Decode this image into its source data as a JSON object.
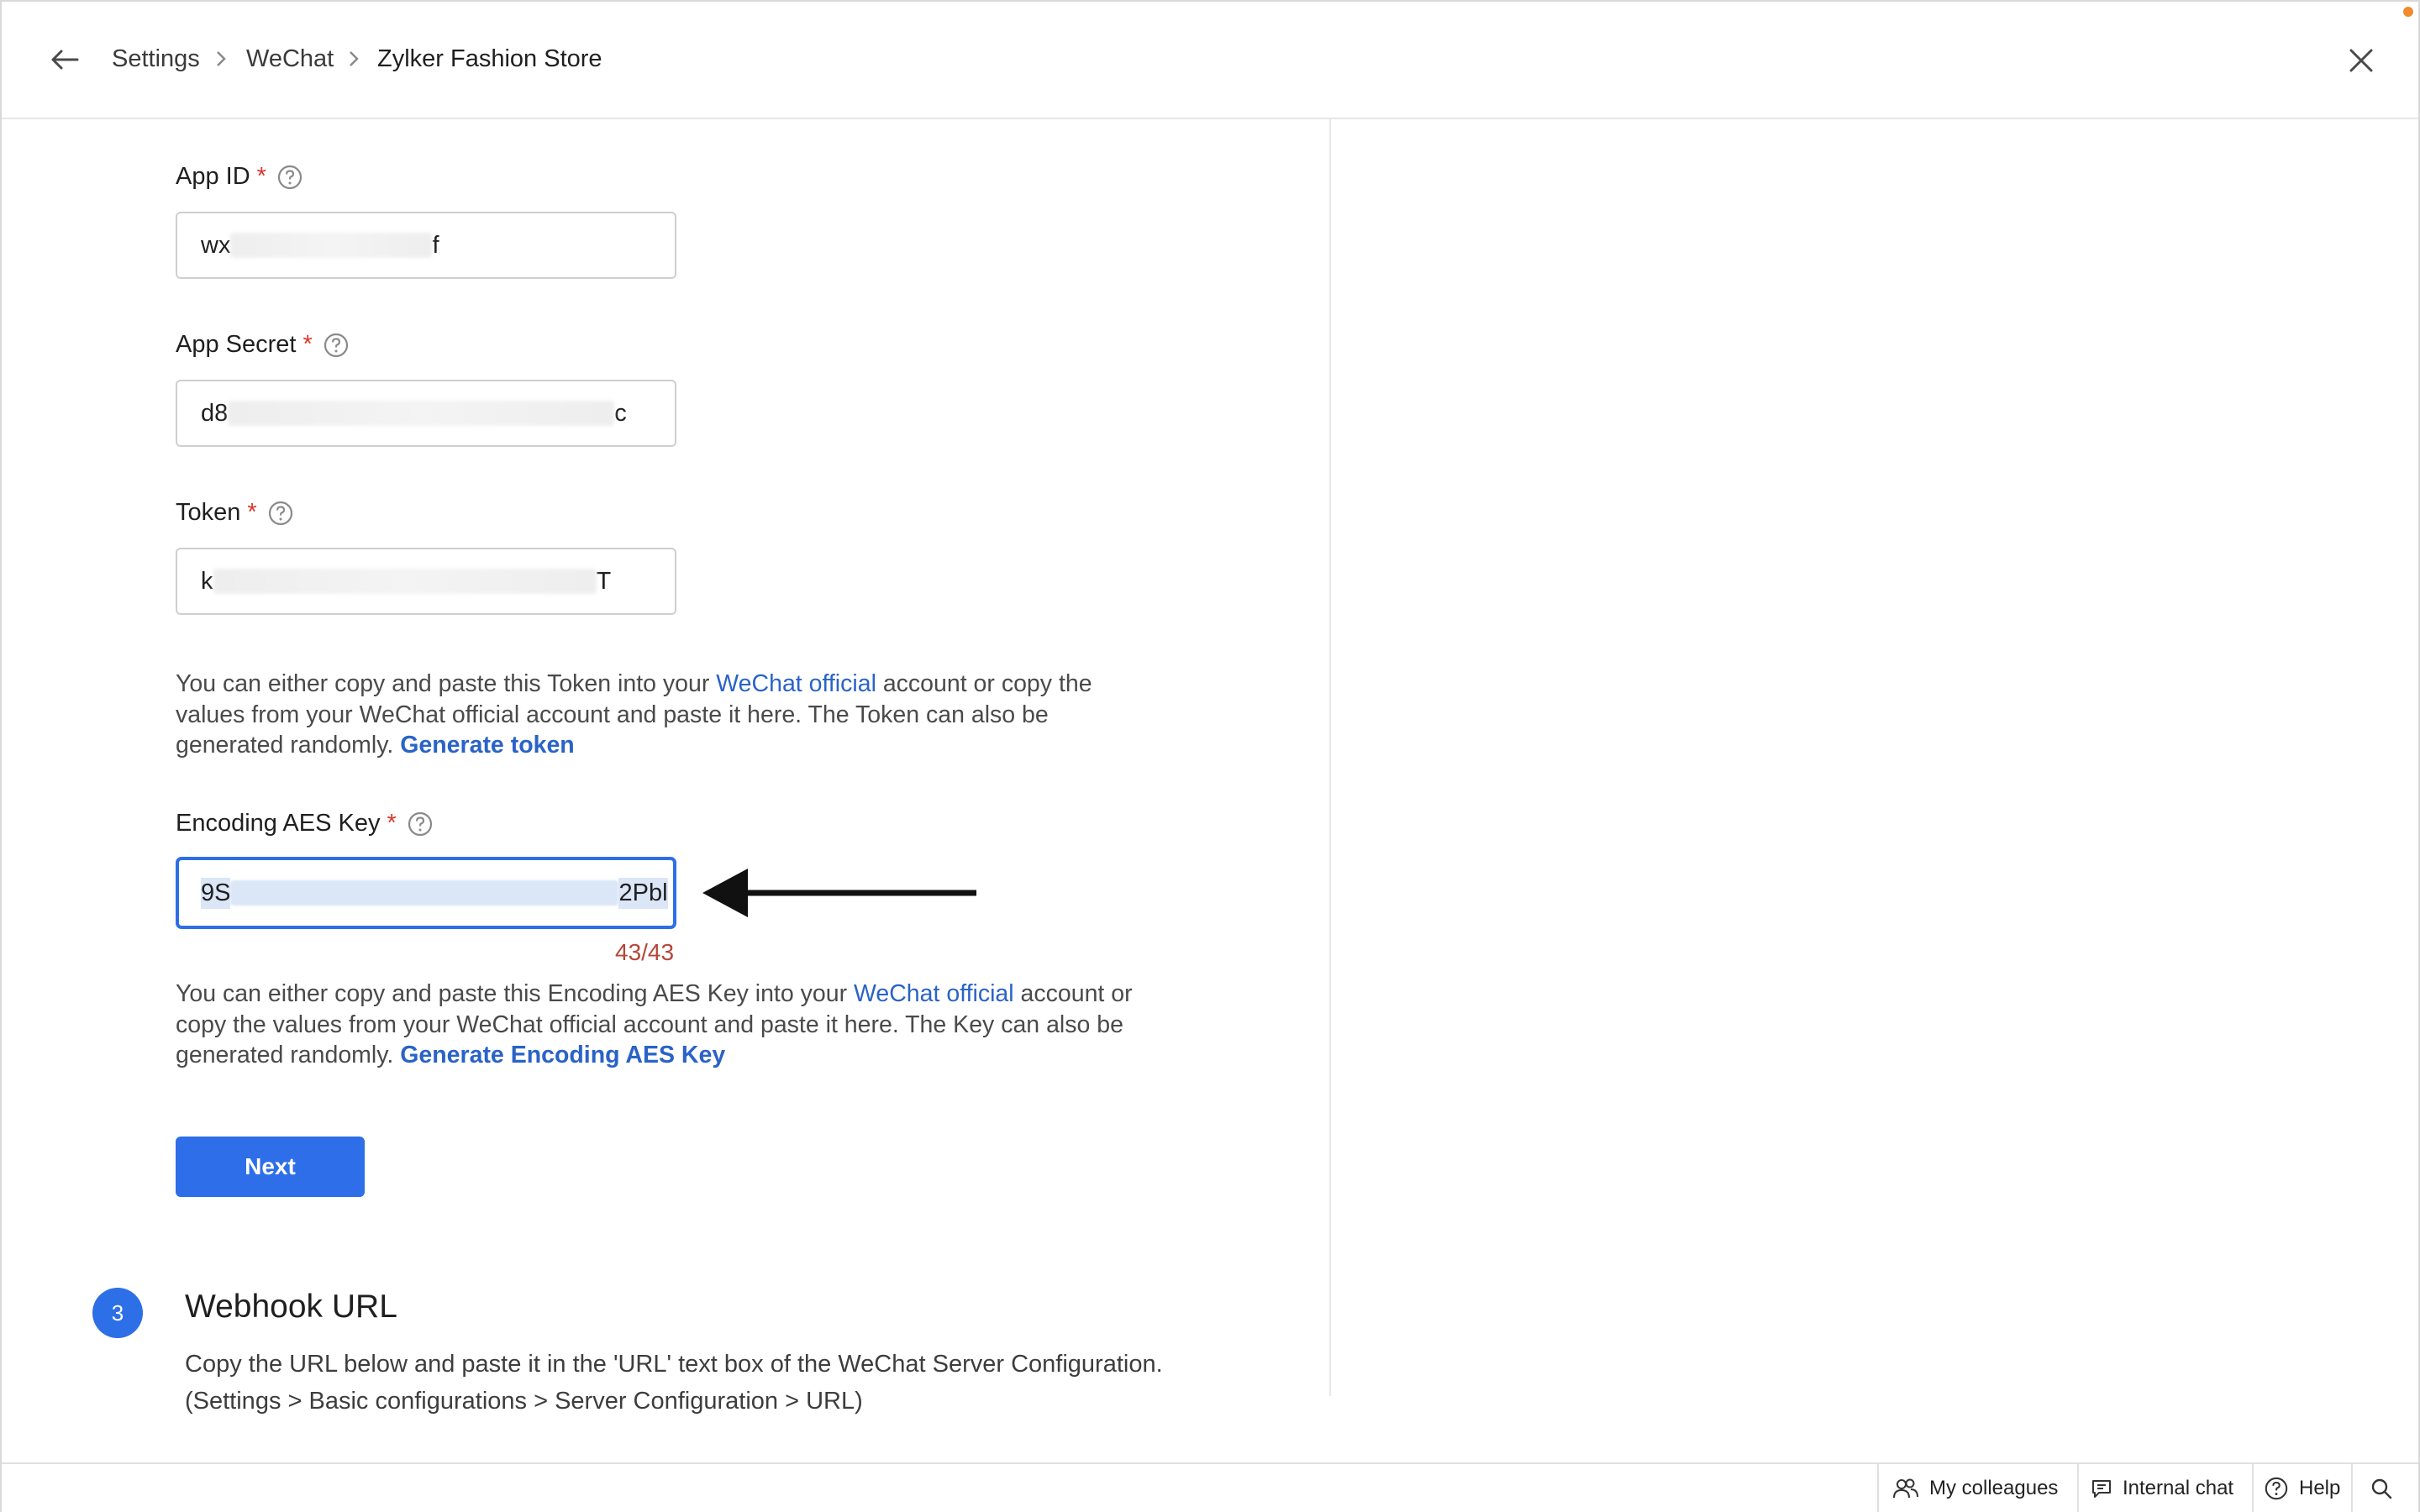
{
  "header": {
    "breadcrumb": [
      "Settings",
      "WeChat",
      "Zylker Fashion Store"
    ]
  },
  "form": {
    "app_id": {
      "label": "App ID",
      "required_mark": "*",
      "value_start": "wx",
      "value_end": "f"
    },
    "app_secret": {
      "label": "App Secret",
      "required_mark": "*",
      "value_start": "d8",
      "value_end": "c"
    },
    "token": {
      "label": "Token",
      "required_mark": "*",
      "value_start": "k",
      "value_end": "T"
    },
    "token_help": {
      "text_1": "You can either copy and paste this Token into your ",
      "link_official": "WeChat official",
      "text_2": " account or copy the values from your WeChat official account and paste it here. The Token can also be generated randomly. ",
      "link_generate": "Generate token"
    },
    "aes_key": {
      "label": "Encoding AES Key",
      "required_mark": "*",
      "value_start": "9S",
      "value_end": "2Pbl",
      "counter": "43/43"
    },
    "aes_help": {
      "text_1": "You can either copy and paste this Encoding AES Key into your ",
      "link_official": "WeChat official",
      "text_2": " account or copy the values from your WeChat official account and paste it here. The Key can also be generated randomly. ",
      "link_generate": "Generate Encoding AES Key"
    },
    "next_label": "Next"
  },
  "step": {
    "number": "3",
    "title": "Webhook URL",
    "desc_line1": "Copy the URL below and paste it in the 'URL' text box of the WeChat Server Configuration.",
    "desc_line2": "(Settings > Basic configurations > Server Configuration > URL)"
  },
  "footer": {
    "colleagues": "My colleagues",
    "internal_chat": "Internal chat",
    "help": "Help"
  },
  "colors": {
    "accent": "#2e6ee8",
    "link": "#2a63c7",
    "required": "#d9362b",
    "counter": "#b5463a"
  }
}
